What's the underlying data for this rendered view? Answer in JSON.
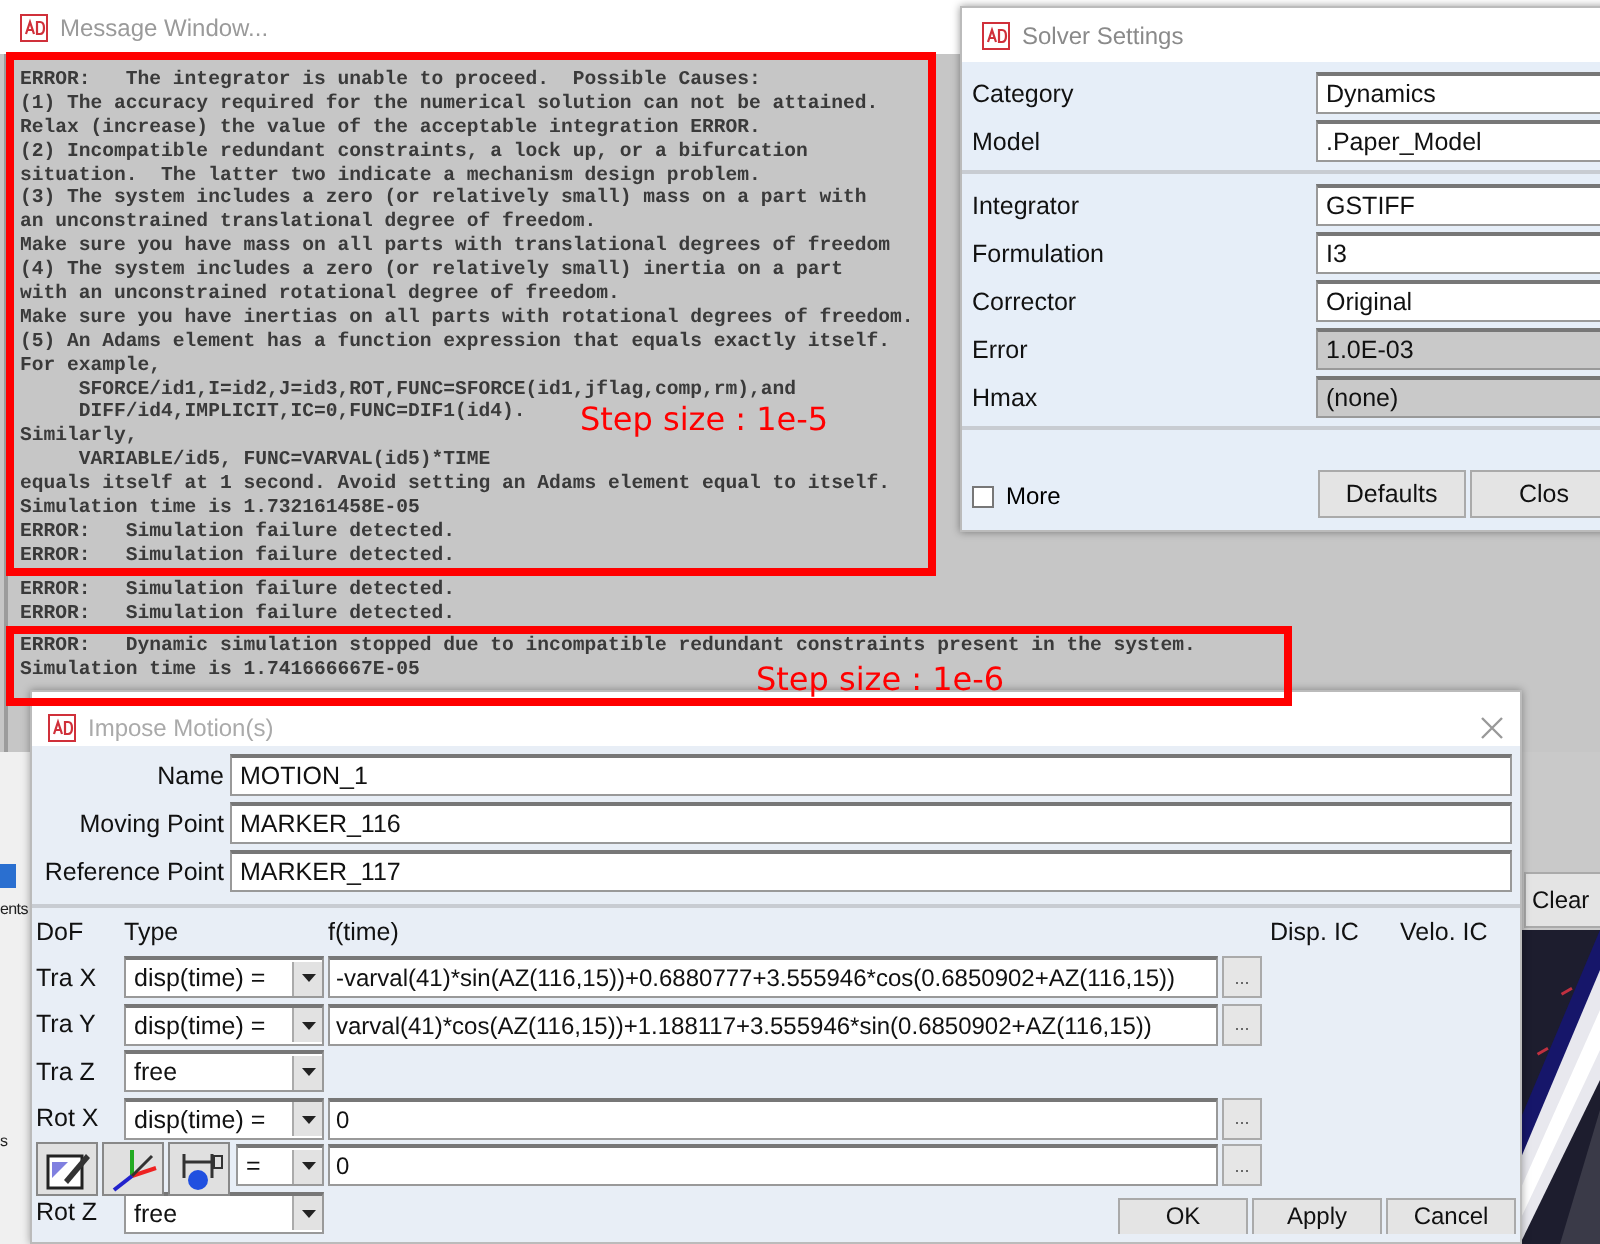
{
  "message_window": {
    "title": "Message Window...",
    "lines": [
      "ERROR:   The integrator is unable to proceed.  Possible Causes:",
      "(1) The accuracy required for the numerical solution can not be attained.",
      "Relax (increase) the value of the acceptable integration ERROR.",
      "(2) Incompatible redundant constraints, a lock up, or a bifurcation",
      "situation.  The latter two indicate a mechanism design problem.",
      "(3) The system includes a zero (or relatively small) mass on a part with",
      "an unconstrained translational degree of freedom.",
      "Make sure you have mass on all parts with translational degrees of freedom",
      "(4) The system includes a zero (or relatively small) inertia on a part",
      "with an unconstrained rotational degree of freedom.",
      "Make sure you have inertias on all parts with rotational degrees of freedom.",
      "(5) An Adams element has a function expression that equals exactly itself.",
      "For example,",
      "     SFORCE/id1,I=id2,J=id3,ROT,FUNC=SFORCE(id1,jflag,comp,rm),and",
      "     DIFF/id4,IMPLICIT,IC=0,FUNC=DIF1(id4).",
      "Similarly,",
      "     VARIABLE/id5, FUNC=VARVAL(id5)*TIME",
      "equals itself at 1 second. Avoid setting an Adams element equal to itself.",
      "Simulation time is 1.732161458E-05",
      "ERROR:   Simulation failure detected.",
      "ERROR:   Simulation failure detected.",
      "ERROR:   Simulation failure detected.",
      "ERROR:   Simulation failure detected.",
      "ERROR:   Dynamic simulation stopped due to incompatible redundant constraints present in the system.",
      "Simulation time is 1.741666667E-05"
    ]
  },
  "annotations": [
    {
      "text": "Step size : 1e-5"
    },
    {
      "text": "Step size : 1e-6"
    }
  ],
  "solver_settings": {
    "title": "Solver Settings",
    "groups": [
      [
        {
          "label": "Category",
          "value": "Dynamics",
          "disabled": false
        },
        {
          "label": "Model",
          "value": ".Paper_Model",
          "disabled": false
        }
      ],
      [
        {
          "label": "Integrator",
          "value": "GSTIFF",
          "disabled": false
        },
        {
          "label": "Formulation",
          "value": "I3",
          "disabled": false
        },
        {
          "label": "Corrector",
          "value": "Original",
          "disabled": false
        },
        {
          "label": "Error",
          "value": "1.0E-03",
          "disabled": true
        },
        {
          "label": "Hmax",
          "value": "(none)",
          "disabled": true
        }
      ]
    ],
    "more": {
      "label": "More",
      "checked": false
    },
    "buttons": [
      "Defaults",
      "Clos"
    ]
  },
  "background_window": {
    "fragments": [
      "ents",
      "s"
    ],
    "clear_button": "Clear"
  },
  "impose_motion": {
    "title": "Impose Motion(s)",
    "fields": [
      {
        "label": "Name",
        "value": "MOTION_1"
      },
      {
        "label": "Moving Point",
        "value": "MARKER_116"
      },
      {
        "label": "Reference Point",
        "value": "MARKER_117"
      }
    ],
    "columns": [
      "DoF",
      "Type",
      "f(time)",
      "Disp. IC",
      "Velo. IC"
    ],
    "rows": [
      {
        "dof": "Tra X",
        "type": "disp(time) =",
        "expression": "-varval(41)*sin(AZ(116,15))+0.6880777+3.555946*cos(0.6850902+AZ(116,15))",
        "button": "..."
      },
      {
        "dof": "Tra Y",
        "type": "disp(time) =",
        "expression": "varval(41)*cos(AZ(116,15))+1.188117+3.555946*sin(0.6850902+AZ(116,15))",
        "button": "..."
      },
      {
        "dof": "Tra Z",
        "type": "free"
      },
      {
        "dof": "Rot X",
        "type": "disp(time) =",
        "expression": "0",
        "button": "..."
      },
      {
        "type": "=",
        "expression": "0",
        "button": "..."
      },
      {
        "dof": "Rot Z",
        "type": "free"
      }
    ],
    "buttons": [
      "OK",
      "Apply",
      "Cancel"
    ]
  }
}
